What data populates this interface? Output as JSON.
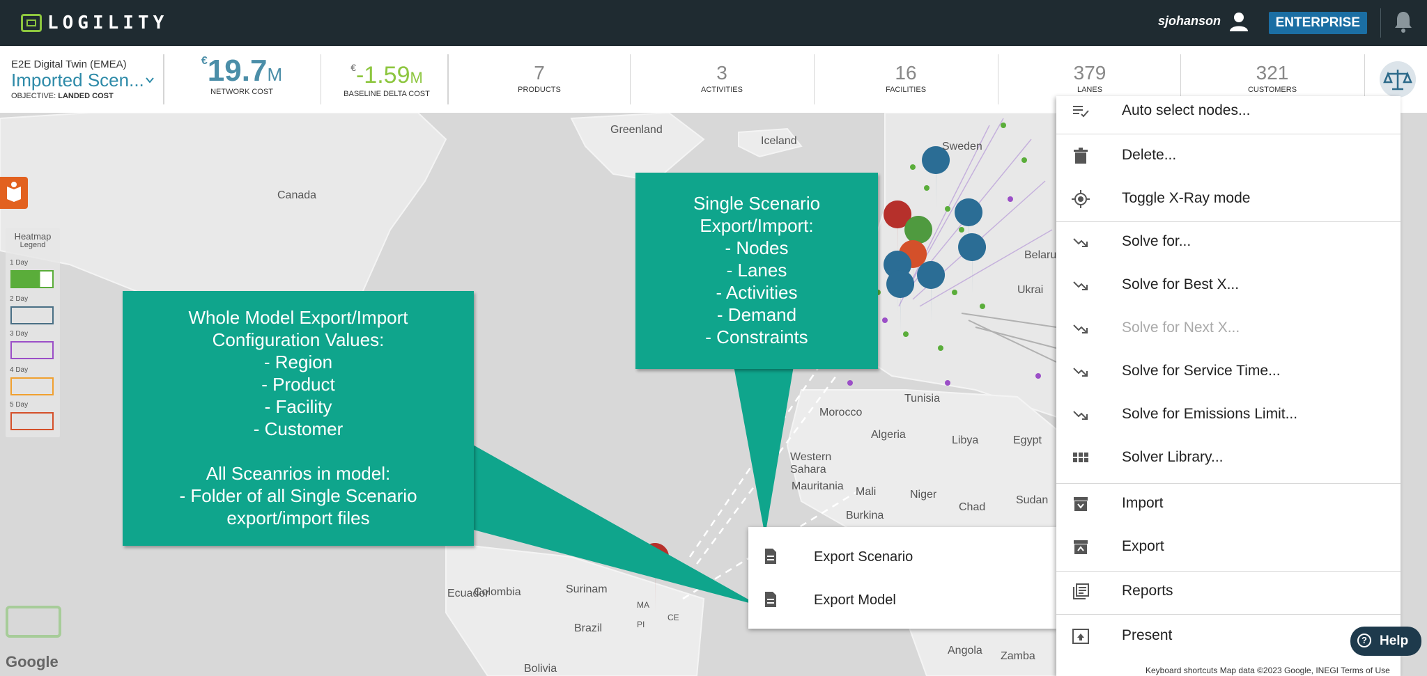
{
  "header": {
    "logo_text": "LOGILITY",
    "username": "sjohanson",
    "edition": "ENTERPRISE"
  },
  "scenario": {
    "subtitle": "E2E Digital Twin (EMEA)",
    "name": "Imported Scen...",
    "objective_label": "OBJECTIVE:",
    "objective_value": "LANDED COST"
  },
  "kpis": {
    "network_cost": {
      "currency": "€",
      "value": "19.7",
      "unit": "M",
      "label": "NETWORK COST"
    },
    "baseline_delta": {
      "currency": "€",
      "value": "-1.59",
      "unit": "M",
      "label": "BASELINE DELTA COST"
    },
    "products": {
      "value": "7",
      "label": "PRODUCTS"
    },
    "activities": {
      "value": "3",
      "label": "ACTIVITIES"
    },
    "facilities": {
      "value": "16",
      "label": "FACILITIES"
    },
    "lanes": {
      "value": "379",
      "label": "LANES"
    },
    "customers": {
      "value": "321",
      "label": "CUSTOMERS"
    }
  },
  "legend": {
    "title": "Heatmap",
    "subtitle": "Legend",
    "items": [
      {
        "label": "1 Day",
        "color": "#5aad3a"
      },
      {
        "label": "2 Day",
        "color": "#4a6f85"
      },
      {
        "label": "3 Day",
        "color": "#9b4fc7"
      },
      {
        "label": "4 Day",
        "color": "#f0a030"
      },
      {
        "label": "5 Day",
        "color": "#d4502a"
      }
    ]
  },
  "map_labels": {
    "greenland": "Greenland",
    "canada": "Canada",
    "iceland": "Iceland",
    "sweden": "Sweden",
    "belarus": "Belarus",
    "ukraine": "Ukrai",
    "tunisia": "Tunisia",
    "morocco": "Morocco",
    "algeria": "Algeria",
    "libya": "Libya",
    "egypt": "Egypt",
    "western_sahara": "Western\nSahara",
    "mauritania": "Mauritania",
    "mali": "Mali",
    "niger": "Niger",
    "chad": "Chad",
    "sudan": "Sudan",
    "burkina": "Burkina",
    "colombia": "Colombia",
    "suriname": "Surinam",
    "ecuador": "Ecuador",
    "brazil": "Brazil",
    "pi": "PI",
    "ce": "CE",
    "ma": "MA",
    "bolivia": "Bolivia",
    "angola": "Angola",
    "zambia": "Zamba",
    "google": "Google"
  },
  "callouts": {
    "whole_model": [
      "Whole Model Export/Import",
      "Configuration Values:",
      "- Region",
      "- Product",
      "- Facility",
      "- Customer",
      "",
      "All Sceanrios in model:",
      "- Folder of all Single Scenario",
      "export/import files"
    ],
    "single_scenario": [
      "Single Scenario",
      "Export/Import:",
      "- Nodes",
      "- Lanes",
      "- Activities",
      "- Demand",
      "- Constraints"
    ]
  },
  "export_popup": {
    "items": [
      {
        "label": "Export Scenario",
        "icon": "document-icon"
      },
      {
        "label": "Export Model",
        "icon": "document-icon"
      }
    ]
  },
  "menu": {
    "items": [
      {
        "label": "Auto select nodes...",
        "icon": "playlist-check-icon",
        "disabled": false
      },
      {
        "label": "Delete...",
        "icon": "trash-icon",
        "disabled": false
      },
      {
        "label": "Toggle X-Ray mode",
        "icon": "target-icon",
        "disabled": false
      },
      {
        "label": "Solve for...",
        "icon": "trend-arrow-icon",
        "disabled": false
      },
      {
        "label": "Solve for Best X...",
        "icon": "trend-arrow-icon",
        "disabled": false
      },
      {
        "label": "Solve for Next X...",
        "icon": "trend-arrow-icon",
        "disabled": true
      },
      {
        "label": "Solve for Service Time...",
        "icon": "trend-arrow-icon",
        "disabled": false
      },
      {
        "label": "Solve for Emissions Limit...",
        "icon": "trend-arrow-icon",
        "disabled": false
      },
      {
        "label": "Solver Library...",
        "icon": "grid-icon",
        "disabled": false
      },
      {
        "label": "Import",
        "icon": "archive-down-icon",
        "disabled": false
      },
      {
        "label": "Export",
        "icon": "archive-up-icon",
        "disabled": false
      },
      {
        "label": "Reports",
        "icon": "library-icon",
        "disabled": false
      },
      {
        "label": "Present",
        "icon": "present-icon",
        "disabled": false
      }
    ]
  },
  "help": {
    "label": "Help"
  },
  "footer": "Keyboard shortcuts   Map data ©2023 Google, INEGI   Terms of Use",
  "colors": {
    "topbar": "#1f2b31",
    "accent_blue": "#2d8aa8",
    "accent_green": "#8dc63f",
    "callout": "#0fa58c",
    "enterprise_badge": "#1b6ea3"
  }
}
